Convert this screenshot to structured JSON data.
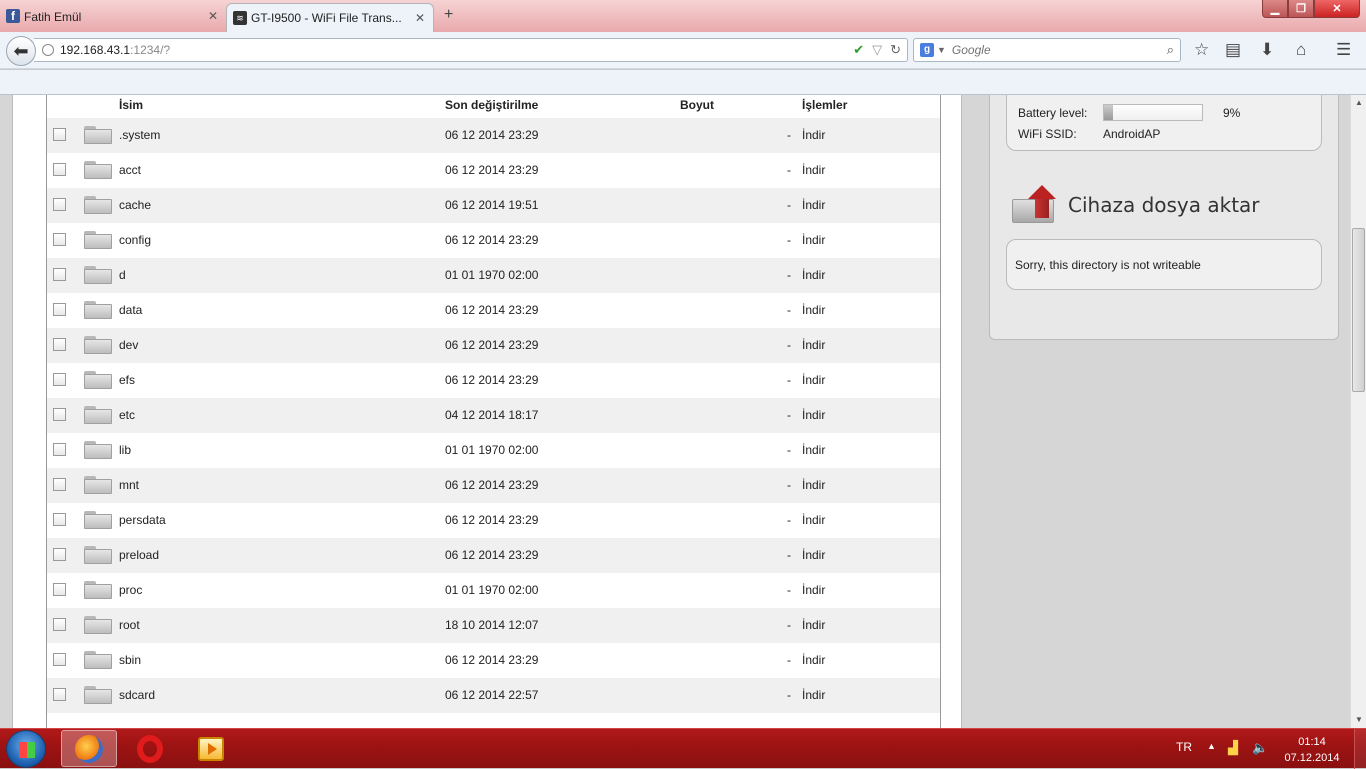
{
  "browser": {
    "tabs": [
      {
        "title": "Fatih Emül",
        "icon": "facebook-icon"
      },
      {
        "title": "GT-I9500 - WiFi File Trans...",
        "icon": "wifi-icon"
      }
    ],
    "new_tab_label": "+",
    "url_host": "192.168.43.1",
    "url_path": ":1234/?",
    "search_placeholder": "Google"
  },
  "table": {
    "headers": {
      "name": "İsim",
      "modified": "Son değiştirilme",
      "size": "Boyut",
      "actions": "İşlemler"
    },
    "rows": [
      {
        "name": ".system",
        "date": "06 12 2014 23:29",
        "size": "-",
        "action": "İndir"
      },
      {
        "name": "acct",
        "date": "06 12 2014 23:29",
        "size": "-",
        "action": "İndir"
      },
      {
        "name": "cache",
        "date": "06 12 2014 19:51",
        "size": "-",
        "action": "İndir"
      },
      {
        "name": "config",
        "date": "06 12 2014 23:29",
        "size": "-",
        "action": "İndir"
      },
      {
        "name": "d",
        "date": "01 01 1970 02:00",
        "size": "-",
        "action": "İndir"
      },
      {
        "name": "data",
        "date": "06 12 2014 23:29",
        "size": "-",
        "action": "İndir"
      },
      {
        "name": "dev",
        "date": "06 12 2014 23:29",
        "size": "-",
        "action": "İndir"
      },
      {
        "name": "efs",
        "date": "06 12 2014 23:29",
        "size": "-",
        "action": "İndir"
      },
      {
        "name": "etc",
        "date": "04 12 2014 18:17",
        "size": "-",
        "action": "İndir"
      },
      {
        "name": "lib",
        "date": "01 01 1970 02:00",
        "size": "-",
        "action": "İndir"
      },
      {
        "name": "mnt",
        "date": "06 12 2014 23:29",
        "size": "-",
        "action": "İndir"
      },
      {
        "name": "persdata",
        "date": "06 12 2014 23:29",
        "size": "-",
        "action": "İndir"
      },
      {
        "name": "preload",
        "date": "06 12 2014 23:29",
        "size": "-",
        "action": "İndir"
      },
      {
        "name": "proc",
        "date": "01 01 1970 02:00",
        "size": "-",
        "action": "İndir"
      },
      {
        "name": "root",
        "date": "18 10 2014 12:07",
        "size": "-",
        "action": "İndir"
      },
      {
        "name": "sbin",
        "date": "06 12 2014 23:29",
        "size": "-",
        "action": "İndir"
      },
      {
        "name": "sdcard",
        "date": "06 12 2014 22:57",
        "size": "-",
        "action": "İndir"
      }
    ]
  },
  "device_info": {
    "battery_label": "Battery level:",
    "battery_value": "9%",
    "battery_fraction": 0.09,
    "ssid_label": "WiFi SSID:",
    "ssid_value": "AndroidAP"
  },
  "upload": {
    "heading": "Cihaza dosya aktar",
    "message": "Sorry, this directory is not writeable"
  },
  "taskbar": {
    "apps": [
      "firefox-icon",
      "opera-icon",
      "media-player-icon"
    ],
    "language": "TR",
    "time": "01:14",
    "date": "07.12.2014"
  }
}
